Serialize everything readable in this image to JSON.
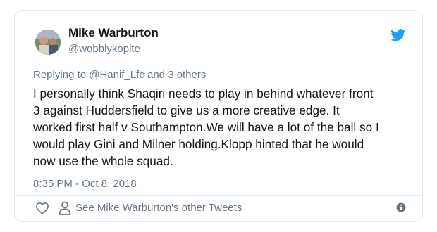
{
  "tweet": {
    "author_name": "Mike Warburton",
    "author_handle": "@wobblykopite",
    "reply_prefix": "Replying to ",
    "reply_mention": "@Hanif_Lfc",
    "reply_suffix": " and 3 others",
    "body_lines": [
      "I personally think Shaqiri needs to play in behind whatever front",
      "3 against Huddersfield to give us a more creative edge. It",
      "worked first half v Southampton.We will have a lot of the ball so I",
      "would play Gini and Milner holding.Klopp hinted that he would",
      "now use the whole squad."
    ],
    "timestamp": "8:35 PM - Oct 8, 2018"
  },
  "actions": {
    "see_other_tweets": "See Mike Warburton's other Tweets"
  },
  "icons": {
    "brand": "twitter-bird-icon",
    "like": "heart-icon",
    "profile": "person-icon",
    "info": "info-icon"
  },
  "colors": {
    "twitter_blue": "#1da1f2",
    "secondary_text": "#657786",
    "primary_text": "#14171a",
    "border": "#e1e8ed"
  }
}
